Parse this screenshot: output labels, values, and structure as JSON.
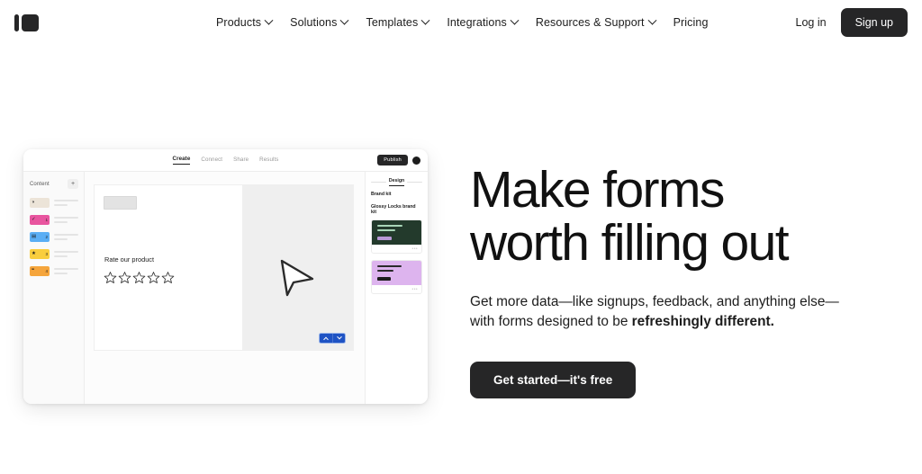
{
  "brand": {
    "logo_name": "typeform-logo",
    "dark": "#262627",
    "accent_blue": "#1f53c4"
  },
  "nav": {
    "items": [
      {
        "label": "Products",
        "has_dropdown": true
      },
      {
        "label": "Solutions",
        "has_dropdown": true
      },
      {
        "label": "Templates",
        "has_dropdown": true
      },
      {
        "label": "Integrations",
        "has_dropdown": true
      },
      {
        "label": "Resources & Support",
        "has_dropdown": true
      },
      {
        "label": "Pricing",
        "has_dropdown": false
      }
    ],
    "login_label": "Log in",
    "signup_label": "Sign up"
  },
  "hero": {
    "headline": "Make forms\nworth filling out",
    "subtitle_plain_1": "Get more data—like signups, feedback, and anything else—with forms designed to be ",
    "subtitle_bold": "refreshingly different.",
    "cta_label": "Get started—it's free"
  },
  "mockup": {
    "tabs": [
      {
        "label": "Create",
        "active": true
      },
      {
        "label": "Connect",
        "active": false
      },
      {
        "label": "Share",
        "active": false
      },
      {
        "label": "Results",
        "active": false
      }
    ],
    "publish_label": "Publish",
    "sidebar": {
      "title": "Content",
      "add_label": "+",
      "questions": [
        {
          "glyph": "◑",
          "num": "",
          "color": "#ece4d8"
        },
        {
          "glyph": "✓",
          "num": "1",
          "color": "#e8559f"
        },
        {
          "glyph": "▤",
          "num": "2",
          "color": "#5aaef5"
        },
        {
          "glyph": "★",
          "num": "3",
          "color": "#f9ce3e"
        },
        {
          "glyph": "❝",
          "num": "4",
          "color": "#f5a53c"
        }
      ]
    },
    "canvas": {
      "question_text": "Rate our product",
      "star_count": 5,
      "cursor_icon": "pointer-arrow-icon",
      "prev_icon": "chevron-up-icon",
      "next_icon": "chevron-down-icon"
    },
    "design_panel": {
      "tab_label": "Design",
      "section_label": "Brand kit",
      "kit_name": "Glossy Locks brand kit",
      "kits": [
        {
          "name": "dark-green-kit",
          "bg": "#233a2c",
          "bars": [
            "#a9d6b8",
            "#a9d6b8",
            "#b898d6"
          ],
          "menu": "•••"
        },
        {
          "name": "lavender-kit",
          "bg": "#ddb4ee",
          "bars": [
            "#2a2a2a",
            "#2a2a2a",
            "#1c1c1c"
          ],
          "menu": "•••"
        }
      ]
    }
  }
}
